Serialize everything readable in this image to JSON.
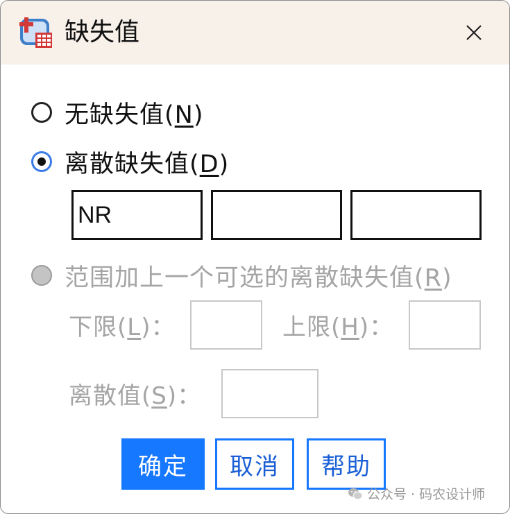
{
  "window": {
    "title": "缺失值",
    "app_icon": "table-app-icon",
    "close_icon": "close-icon"
  },
  "options": {
    "no_missing": {
      "label": "无缺失值(",
      "mnemonic": "N",
      "suffix": ")",
      "selected": false
    },
    "discrete": {
      "label": "离散缺失值(",
      "mnemonic": "D",
      "suffix": ")",
      "selected": true
    },
    "range": {
      "label": "范围加上一个可选的离散缺失值(",
      "mnemonic": "R",
      "suffix": ")",
      "selected": false,
      "enabled": false
    }
  },
  "discrete_values": [
    "NR",
    "",
    ""
  ],
  "range": {
    "low_label": "下限(",
    "low_mnemonic": "L",
    "low_suffix": ")：",
    "high_label": "上限(",
    "high_mnemonic": "H",
    "high_suffix": ")：",
    "discrete_label": "离散值(",
    "discrete_mnemonic": "S",
    "discrete_suffix": ")：",
    "low_value": "",
    "high_value": "",
    "discrete_value": ""
  },
  "buttons": {
    "ok": "确定",
    "cancel": "取消",
    "help": "帮助"
  },
  "colors": {
    "accent": "#1677ff",
    "titlebar": "#f8f1ea",
    "disabled": "#a5a5a5"
  },
  "watermark": "公众号 · 码农设计师"
}
